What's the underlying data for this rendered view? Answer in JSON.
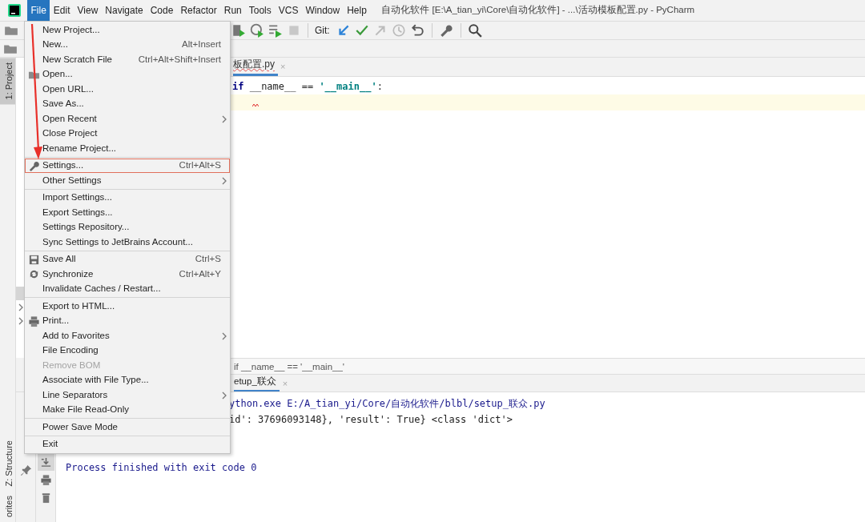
{
  "window": {
    "title": "自动化软件 [E:\\A_tian_yi\\Core\\自动化软件] - ...\\活动模板配置.py - PyCharm"
  },
  "menu_bar": [
    {
      "label": "File",
      "selected": true
    },
    {
      "label": "Edit",
      "selected": false
    },
    {
      "label": "View",
      "selected": false
    },
    {
      "label": "Navigate",
      "selected": false
    },
    {
      "label": "Code",
      "selected": false
    },
    {
      "label": "Refactor",
      "selected": false
    },
    {
      "label": "Run",
      "selected": false
    },
    {
      "label": "Tools",
      "selected": false
    },
    {
      "label": "VCS",
      "selected": false
    },
    {
      "label": "Window",
      "selected": false
    },
    {
      "label": "Help",
      "selected": false
    }
  ],
  "toolbar": {
    "git_label": "Git:"
  },
  "tool_stripe": [
    {
      "label": "1: Project",
      "selected": true,
      "kind": "top"
    },
    {
      "label": "Z: Structure",
      "selected": false,
      "kind": "bottom"
    },
    {
      "label": "orites",
      "selected": false,
      "kind": "bottom"
    }
  ],
  "project_tree": [
    {
      "selected": true
    },
    {
      "selected": false,
      "expanded": false
    },
    {
      "selected": false,
      "expanded": false
    }
  ],
  "editor": {
    "tab": {
      "label": "板配置.py",
      "close": "×"
    },
    "lines": [
      {
        "current": false,
        "error_mark": false,
        "tokens": [
          {
            "text": "if",
            "kind": "keyword"
          },
          {
            "text": " __name__ == ",
            "kind": "plain"
          },
          {
            "text": "'__main__'",
            "kind": "string"
          },
          {
            "text": ":",
            "kind": "plain"
          }
        ]
      },
      {
        "current": true,
        "error_mark": true
      }
    ],
    "breadcrumb": "if __name__ == '__main__'"
  },
  "run_panel": {
    "tab": "etup_联众",
    "tab_close": "×",
    "tools": [
      {
        "kind": "scroll",
        "on": true
      },
      {
        "kind": "print",
        "on": false
      },
      {
        "kind": "trash",
        "on": false
      }
    ],
    "lines": [
      {
        "kind": "command",
        "text": "ython.exe E:/A_tian_yi/Core/自动化软件/blbl/setup_联众.py"
      },
      {
        "kind": "output",
        "text": "id': 37696093148}, 'result': True} <class 'dict'>"
      },
      {
        "kind": "exit",
        "text": "Process finished with exit code 0"
      }
    ]
  },
  "file_menu": [
    {
      "kind": "item",
      "label": "New Project...",
      "submenu": false,
      "disabled": false,
      "highlighted": false
    },
    {
      "kind": "item",
      "label": "New...",
      "shortcut": "Alt+Insert",
      "submenu": false,
      "disabled": false,
      "highlighted": false
    },
    {
      "kind": "item",
      "label": "New Scratch File",
      "shortcut": "Ctrl+Alt+Shift+Insert",
      "submenu": false,
      "disabled": false,
      "highlighted": false
    },
    {
      "kind": "folder",
      "label": "Open...",
      "submenu": false,
      "disabled": false,
      "highlighted": false
    },
    {
      "kind": "item",
      "label": "Open URL...",
      "submenu": false,
      "disabled": false,
      "highlighted": false
    },
    {
      "kind": "item",
      "label": "Save As...",
      "submenu": false,
      "disabled": false,
      "highlighted": false
    },
    {
      "kind": "item",
      "label": "Open Recent",
      "submenu": true,
      "disabled": false,
      "highlighted": false
    },
    {
      "kind": "item",
      "label": "Close Project",
      "submenu": false,
      "disabled": false,
      "highlighted": false
    },
    {
      "kind": "item",
      "label": "Rename Project...",
      "submenu": false,
      "disabled": false,
      "highlighted": false
    },
    {
      "kind": "separator"
    },
    {
      "kind": "wrench",
      "label": "Settings...",
      "shortcut": "Ctrl+Alt+S",
      "submenu": false,
      "disabled": false,
      "highlighted": true
    },
    {
      "kind": "item",
      "label": "Other Settings",
      "submenu": true,
      "disabled": false,
      "highlighted": false
    },
    {
      "kind": "separator"
    },
    {
      "kind": "item",
      "label": "Import Settings...",
      "submenu": false,
      "disabled": false,
      "highlighted": false
    },
    {
      "kind": "item",
      "label": "Export Settings...",
      "submenu": false,
      "disabled": false,
      "highlighted": false
    },
    {
      "kind": "item",
      "label": "Settings Repository...",
      "submenu": false,
      "disabled": false,
      "highlighted": false
    },
    {
      "kind": "item",
      "label": "Sync Settings to JetBrains Account...",
      "submenu": false,
      "disabled": false,
      "highlighted": false
    },
    {
      "kind": "separator"
    },
    {
      "kind": "save",
      "label": "Save All",
      "shortcut": "Ctrl+S",
      "submenu": false,
      "disabled": false,
      "highlighted": false
    },
    {
      "kind": "sync",
      "label": "Synchronize",
      "shortcut": "Ctrl+Alt+Y",
      "submenu": false,
      "disabled": false,
      "highlighted": false
    },
    {
      "kind": "item",
      "label": "Invalidate Caches / Restart...",
      "submenu": false,
      "disabled": false,
      "highlighted": false
    },
    {
      "kind": "separator"
    },
    {
      "kind": "item",
      "label": "Export to HTML...",
      "submenu": false,
      "disabled": false,
      "highlighted": false
    },
    {
      "kind": "print",
      "label": "Print...",
      "submenu": false,
      "disabled": false,
      "highlighted": false
    },
    {
      "kind": "item",
      "label": "Add to Favorites",
      "submenu": true,
      "disabled": false,
      "highlighted": false
    },
    {
      "kind": "item",
      "label": "File Encoding",
      "submenu": false,
      "disabled": false,
      "highlighted": false
    },
    {
      "kind": "item",
      "label": "Remove BOM",
      "submenu": false,
      "disabled": true,
      "highlighted": false
    },
    {
      "kind": "item",
      "label": "Associate with File Type...",
      "submenu": false,
      "disabled": false,
      "highlighted": false
    },
    {
      "kind": "item",
      "label": "Line Separators",
      "submenu": true,
      "disabled": false,
      "highlighted": false
    },
    {
      "kind": "item",
      "label": "Make File Read-Only",
      "submenu": false,
      "disabled": false,
      "highlighted": false
    },
    {
      "kind": "separator"
    },
    {
      "kind": "item",
      "label": "Power Save Mode",
      "submenu": false,
      "disabled": false,
      "highlighted": false
    },
    {
      "kind": "separator"
    },
    {
      "kind": "item",
      "label": "Exit",
      "submenu": false,
      "disabled": false,
      "highlighted": false
    }
  ]
}
